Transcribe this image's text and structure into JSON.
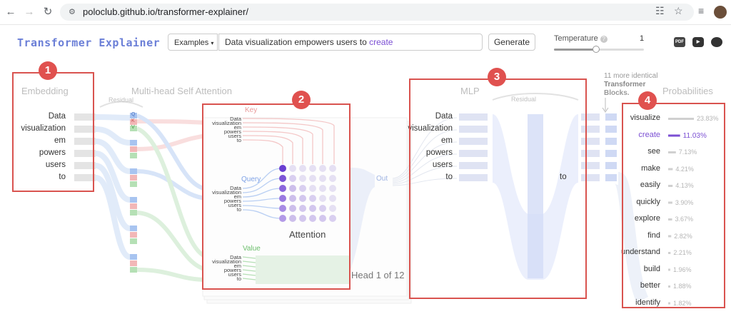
{
  "browser": {
    "url": "poloclub.github.io/transformer-explainer/"
  },
  "header": {
    "logo": "Transformer Explainer",
    "examples_label": "Examples",
    "prompt_text": "Data visualization empowers users to ",
    "prompt_predicted": "create",
    "generate_label": "Generate",
    "temperature_label": "Temperature",
    "temperature_value": "1",
    "temperature_fraction": 0.47
  },
  "sections": {
    "embedding": "Embedding",
    "attention": "Multi-head Self Attention",
    "residual": "Residual",
    "mlp": "MLP",
    "mlp_residual": "Residual",
    "probabilities": "Probabilities",
    "more_blocks_line1": "11 more identical",
    "more_blocks_line2": "Transformer",
    "more_blocks_line3": "Blocks."
  },
  "tokens": [
    "Data",
    "visualization",
    "em",
    "powers",
    "users",
    "to"
  ],
  "mlp_tokens": [
    "Data",
    "visualization",
    "em",
    "powers",
    "users",
    "to"
  ],
  "mlp_out_token": "to",
  "attention": {
    "key_label": "Key",
    "query_label": "Query",
    "value_label": "Value",
    "attention_label": "Attention",
    "out_label": "Out",
    "head_label": "Head 1 of 12",
    "tokens": [
      "Data",
      "visualization",
      "em",
      "powers",
      "users",
      "to"
    ]
  },
  "qkv_letters": [
    "Q",
    "K",
    "V"
  ],
  "annotations": [
    "1",
    "2",
    "3",
    "4"
  ],
  "probabilities": [
    {
      "word": "visualize",
      "value": "23.83%",
      "p": 23.83
    },
    {
      "word": "create",
      "value": "11.03%",
      "p": 11.03
    },
    {
      "word": "see",
      "value": "7.13%",
      "p": 7.13
    },
    {
      "word": "make",
      "value": "4.21%",
      "p": 4.21
    },
    {
      "word": "easily",
      "value": "4.13%",
      "p": 4.13
    },
    {
      "word": "quickly",
      "value": "3.90%",
      "p": 3.9
    },
    {
      "word": "explore",
      "value": "3.67%",
      "p": 3.67
    },
    {
      "word": "find",
      "value": "2.82%",
      "p": 2.82
    },
    {
      "word": "understand",
      "value": "2.21%",
      "p": 2.21
    },
    {
      "word": "build",
      "value": "1.96%",
      "p": 1.96
    },
    {
      "word": "better",
      "value": "1.88%",
      "p": 1.88
    },
    {
      "word": "identify",
      "value": "1.82%",
      "p": 1.82
    }
  ],
  "colors": {
    "accent": "#7b4fd3",
    "annotation": "#d9534f",
    "query": "#a8c4f0",
    "key": "#f2b7b7",
    "value": "#b5e0b5"
  }
}
